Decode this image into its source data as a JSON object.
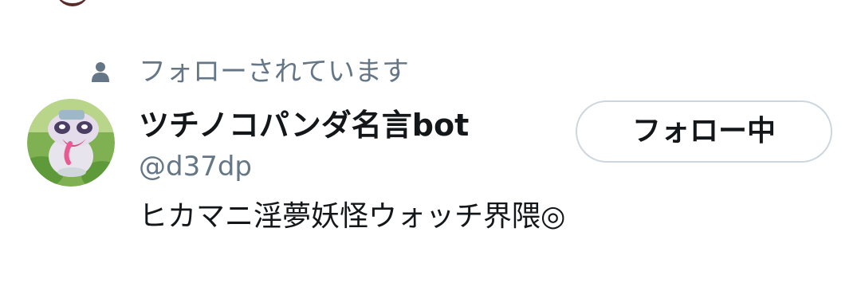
{
  "follows_you": {
    "icon": "person-icon",
    "label": "フォローされています"
  },
  "user": {
    "avatar_icon": "avatar",
    "display_name": "ツチノコパンダ名言bot",
    "handle": "@d37dp",
    "bio": "ヒカマニ淫夢妖怪ウォッチ界隈◎"
  },
  "follow_button": {
    "label": "フォロー中"
  },
  "colors": {
    "primary_text": "#14171a",
    "secondary_text": "#657786",
    "button_border": "#ccd6dd",
    "background": "#ffffff"
  }
}
